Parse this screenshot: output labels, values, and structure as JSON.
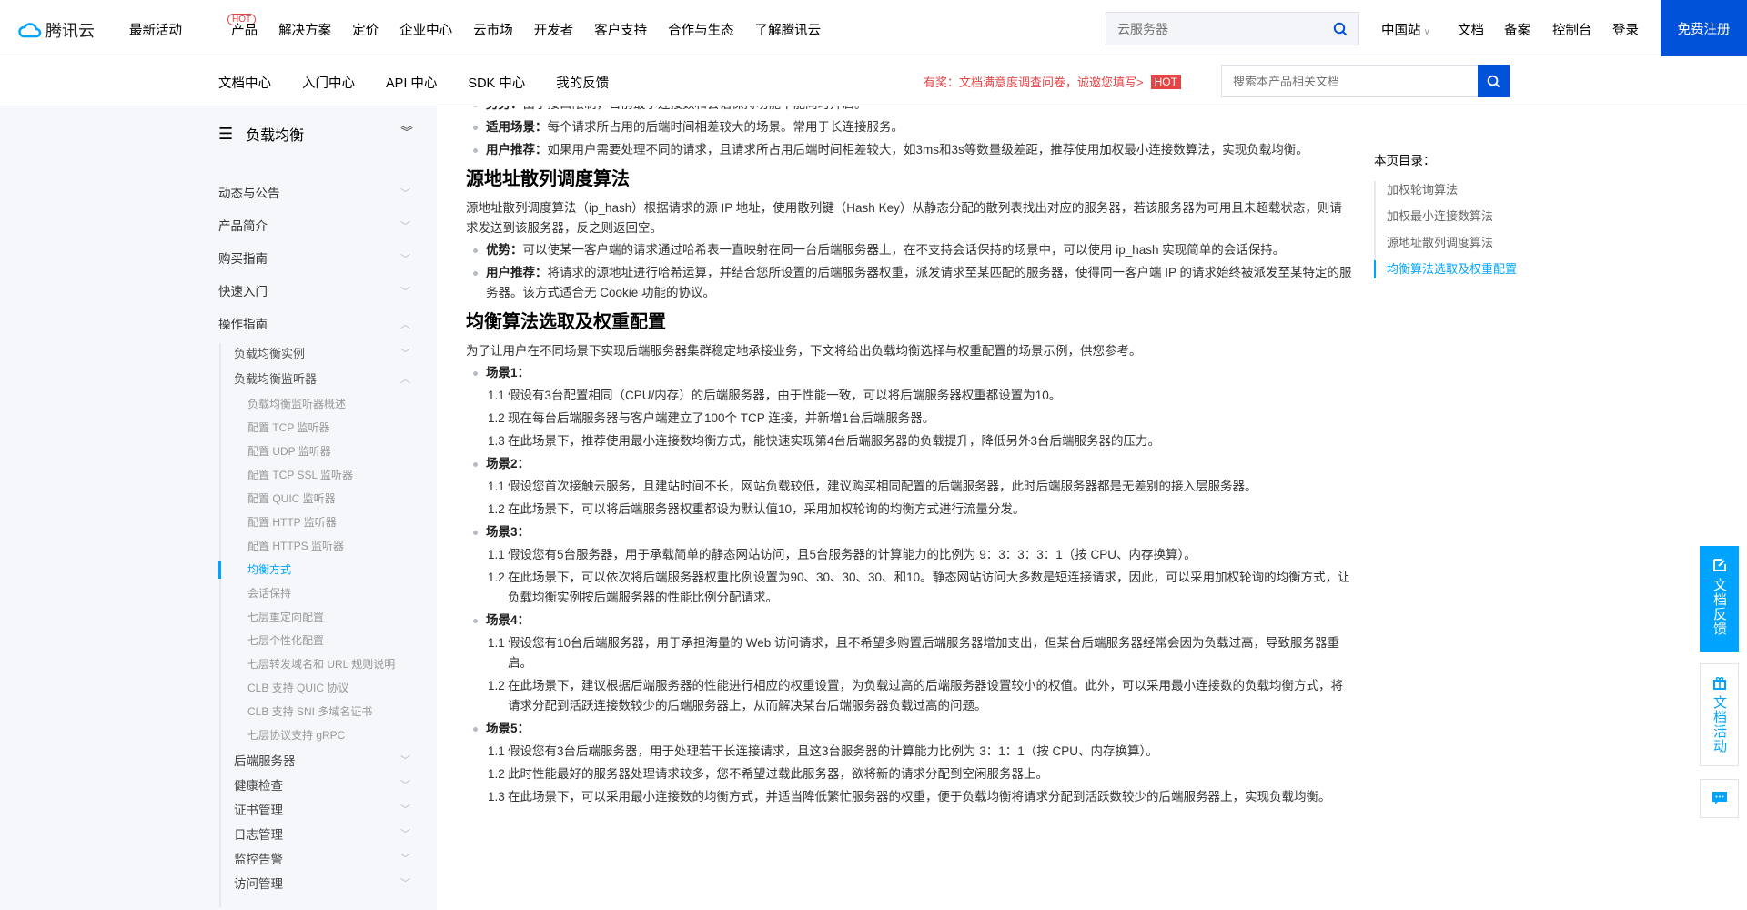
{
  "header": {
    "logo": "腾讯云",
    "nav": [
      {
        "label": "最新活动",
        "badge": "HOT"
      },
      {
        "label": "产品"
      },
      {
        "label": "解决方案"
      },
      {
        "label": "定价"
      },
      {
        "label": "企业中心"
      },
      {
        "label": "云市场"
      },
      {
        "label": "开发者"
      },
      {
        "label": "客户支持"
      },
      {
        "label": "合作与生态"
      },
      {
        "label": "了解腾讯云"
      }
    ],
    "search_placeholder": "云服务器",
    "region": "中国站",
    "links": [
      "文档",
      "备案",
      "控制台",
      "登录"
    ],
    "register": "免费注册",
    "brand_color": "#0052d9"
  },
  "subheader": {
    "nav": [
      "文档中心",
      "入门中心",
      "API 中心",
      "SDK 中心",
      "我的反馈"
    ],
    "survey": "有奖：文档满意度调查问卷，诚邀您填写>",
    "survey_badge": "HOT",
    "search_placeholder": "搜索本产品相关文档"
  },
  "sidebar": {
    "title": "负载均衡",
    "top_items": [
      "动态与公告",
      "产品简介",
      "购买指南",
      "快速入门",
      "操作指南"
    ],
    "guide_items": [
      "负载均衡实例",
      "负载均衡监听器"
    ],
    "listener_items": [
      "负载均衡监听器概述",
      "配置 TCP 监听器",
      "配置 UDP 监听器",
      "配置 TCP SSL 监听器",
      "配置 QUIC 监听器",
      "配置 HTTP 监听器",
      "配置 HTTPS 监听器",
      "均衡方式",
      "会话保持",
      "七层重定向配置",
      "七层个性化配置",
      "七层转发域名和 URL 规则说明",
      "CLB 支持 QUIC 协议",
      "CLB 支持 SNI 多域名证书",
      "七层协议支持 gRPC"
    ],
    "active_item": "均衡方式",
    "bottom_items": [
      "后端服务器",
      "健康检查",
      "证书管理",
      "日志管理",
      "监控告警",
      "访问管理"
    ]
  },
  "content": {
    "top_bullets": [
      {
        "label": "劣势：",
        "text": "由于接口限制，目前最小连接数和会话保持功能不能同时开启。"
      },
      {
        "label": "适用场景：",
        "text": "每个请求所占用的后端时间相差较大的场景。常用于长连接服务。"
      },
      {
        "label": "用户推荐：",
        "text": "如果用户需要处理不同的请求，且请求所占用后端时间相差较大，如3ms和3s等数量级差距，推荐使用加权最小连接数算法，实现负载均衡。"
      }
    ],
    "section1": {
      "title": "源地址散列调度算法",
      "para": "源地址散列调度算法（ip_hash）根据请求的源 IP 地址，使用散列键（Hash Key）从静态分配的散列表找出对应的服务器，若该服务器为可用且未超载状态，则请求发送到该服务器，反之则返回空。",
      "bullets": [
        {
          "label": "优势：",
          "text": "可以使某一客户端的请求通过哈希表一直映射在同一台后端服务器上，在不支持会话保持的场景中，可以使用 ip_hash 实现简单的会话保持。"
        },
        {
          "label": "用户推荐：",
          "text": "将请求的源地址进行哈希运算，并结合您所设置的后端服务器权重，派发请求至某匹配的服务器，使得同一客户端 IP 的请求始终被派发至某特定的服务器。该方式适合无 Cookie 功能的协议。"
        }
      ]
    },
    "section2": {
      "title": "均衡算法选取及权重配置",
      "intro": "为了让用户在不同场景下实现后端服务器集群稳定地承接业务，下文将给出负载均衡选择与权重配置的场景示例，供您参考。",
      "scenarios": [
        {
          "title": "场景1：",
          "steps": [
            {
              "n": "1.1",
              "t": "假设有3台配置相同（CPU/内存）的后端服务器，由于性能一致，可以将后端服务器权重都设置为10。"
            },
            {
              "n": "1.2",
              "t": "现在每台后端服务器与客户端建立了100个 TCP 连接，并新增1台后端服务器。"
            },
            {
              "n": "1.3",
              "t": "在此场景下，推荐使用最小连接数均衡方式，能快速实现第4台后端服务器的负载提升，降低另外3台后端服务器的压力。"
            }
          ]
        },
        {
          "title": "场景2：",
          "steps": [
            {
              "n": "1.1",
              "t": "假设您首次接触云服务，且建站时间不长，网站负载较低，建议购买相同配置的后端服务器，此时后端服务器都是无差别的接入层服务器。"
            },
            {
              "n": "1.2",
              "t": "在此场景下，可以将后端服务器权重都设为默认值10，采用加权轮询的均衡方式进行流量分发。"
            }
          ]
        },
        {
          "title": "场景3：",
          "steps": [
            {
              "n": "1.1",
              "t": "假设您有5台服务器，用于承载简单的静态网站访问，且5台服务器的计算能力的比例为 9：3：3：3：1（按 CPU、内存换算）。"
            },
            {
              "n": "1.2",
              "t": "在此场景下，可以依次将后端服务器权重比例设置为90、30、30、30、和10。静态网站访问大多数是短连接请求，因此，可以采用加权轮询的均衡方式，让负载均衡实例按后端服务器的性能比例分配请求。"
            }
          ]
        },
        {
          "title": "场景4：",
          "steps": [
            {
              "n": "1.1",
              "t": "假设您有10台后端服务器，用于承担海量的 Web 访问请求，且不希望多购置后端服务器增加支出，但某台后端服务器经常会因为负载过高，导致服务器重启。"
            },
            {
              "n": "1.2",
              "t": "在此场景下，建议根据后端服务器的性能进行相应的权重设置，为负载过高的后端服务器设置较小的权值。此外，可以采用最小连接数的负载均衡方式，将请求分配到活跃连接数较少的后端服务器上，从而解决某台后端服务器负载过高的问题。"
            }
          ]
        },
        {
          "title": "场景5：",
          "steps": [
            {
              "n": "1.1",
              "t": "假设您有3台后端服务器，用于处理若干长连接请求，且这3台服务器的计算能力比例为 3：1：1（按 CPU、内存换算）。"
            },
            {
              "n": "1.2",
              "t": "此时性能最好的服务器处理请求较多，您不希望过载此服务器，欲将新的请求分配到空闲服务器上。"
            },
            {
              "n": "1.3",
              "t": "在此场景下，可以采用最小连接数的均衡方式，并适当降低繁忙服务器的权重，便于负载均衡将请求分配到活跃数较少的后端服务器上，实现负载均衡。"
            }
          ]
        }
      ]
    }
  },
  "toc": {
    "title": "本页目录：",
    "items": [
      "加权轮询算法",
      "加权最小连接数算法",
      "源地址散列调度算法",
      "均衡算法选取及权重配置"
    ],
    "active": 3
  },
  "float": {
    "feedback": "文档反馈",
    "activity": "文档活动",
    "accent": "#00a4ff"
  }
}
